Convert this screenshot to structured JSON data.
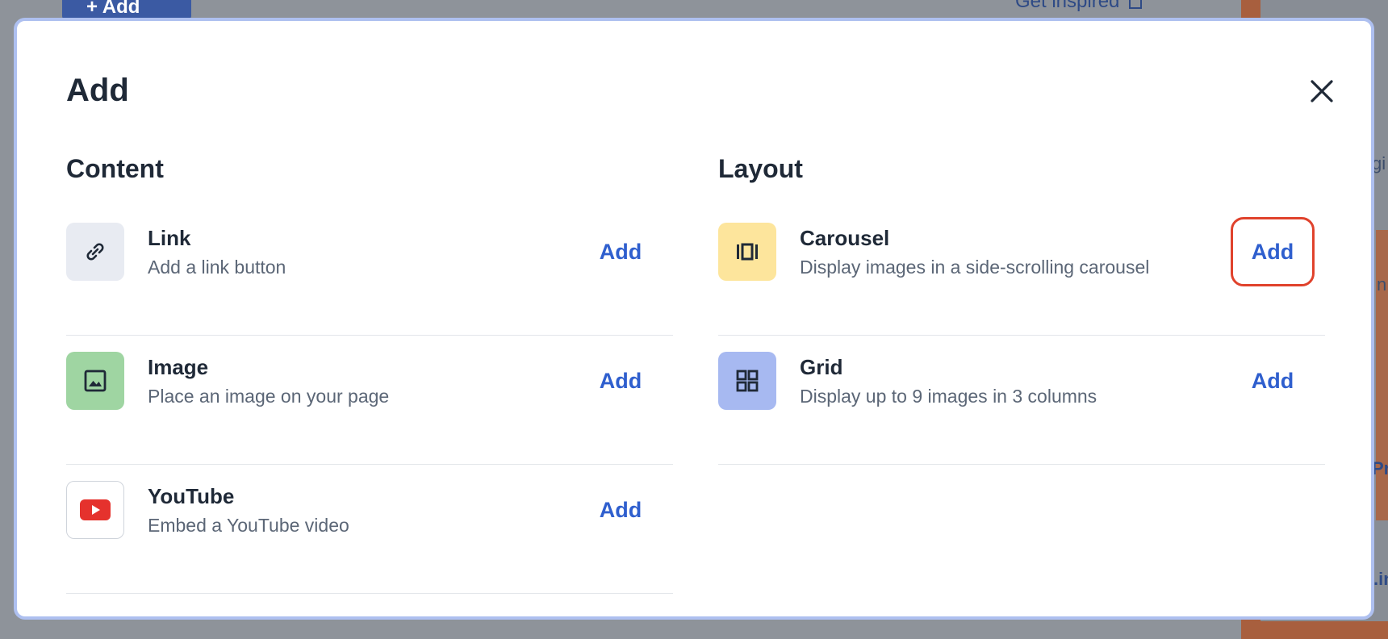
{
  "background": {
    "add_button": "+ Add",
    "inspire_link": "Get inspired",
    "snippets": [
      "gi",
      "n",
      "Pr",
      ".in"
    ]
  },
  "modal": {
    "title": "Add",
    "close_icon": "close-icon",
    "sections": {
      "content": {
        "title": "Content",
        "items": [
          {
            "name": "Link",
            "description": "Add a link button",
            "action": "Add",
            "icon": "link-icon",
            "icon_bg": "#e8ebf2"
          },
          {
            "name": "Image",
            "description": "Place an image on your page",
            "action": "Add",
            "icon": "image-icon",
            "icon_bg": "#9fd5a2"
          },
          {
            "name": "YouTube",
            "description": "Embed a YouTube video",
            "action": "Add",
            "icon": "youtube-icon",
            "icon_bg": "#ffffff"
          }
        ]
      },
      "layout": {
        "title": "Layout",
        "items": [
          {
            "name": "Carousel",
            "description": "Display images in a side-scrolling carousel",
            "action": "Add",
            "icon": "carousel-icon",
            "icon_bg": "#fde59c"
          },
          {
            "name": "Grid",
            "description": "Display up to 9 images in 3 columns",
            "action": "Add",
            "icon": "grid-icon",
            "icon_bg": "#a7b9f1"
          }
        ]
      }
    }
  },
  "colors": {
    "accent": "#2f5fce",
    "focus_ring": "#e0422c",
    "youtube_red": "#e5322d",
    "overlay": "#8e939a"
  }
}
